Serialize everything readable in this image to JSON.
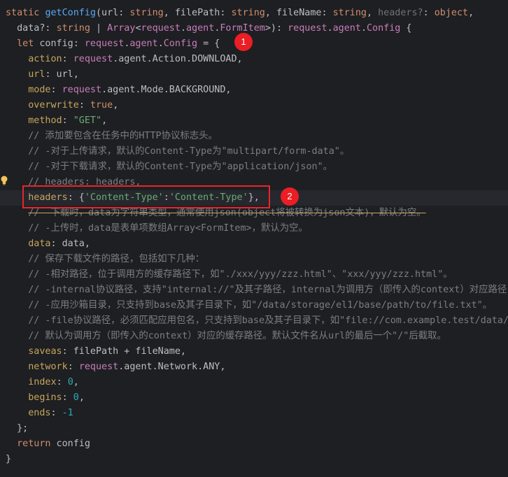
{
  "editor": {
    "lines": [
      "static getConfig(url: string, filePath: string, fileName: string, headers?: object,",
      "  data?: string | Array<request.agent.FormItem>): request.agent.Config {",
      "  let config: request.agent.Config = {",
      "    action: request.agent.Action.DOWNLOAD,",
      "    url: url,",
      "    mode: request.agent.Mode.BACKGROUND,",
      "    overwrite: true,",
      "    method: \"GET\",",
      "    // 添加要包含在任务中的HTTP协议标志头。",
      "    // -对于上传请求，默认的Content-Type为\"multipart/form-data\"。",
      "    // -对于下载请求，默认的Content-Type为\"application/json\"。",
      "    // headers: headers,",
      "    headers: {'Content-Type':'Content-Type'},",
      "    // -下载时，data为字符串类型，通常使用json(object将被转换为json文本)，默认为空。",
      "    // -上传时，data是表单项数组Array<FormItem>，默认为空。",
      "    data: data,",
      "    // 保存下载文件的路径，包括如下几种：",
      "    // -相对路径，位于调用方的缓存路径下，如\"./xxx/yyy/zzz.html\"、\"xxx/yyy/zzz.html\"。",
      "    // -internal协议路径，支持\"internal://\"及其子路径，internal为调用方（即传入的context）对应路径，",
      "    // -应用沙箱目录，只支持到base及其子目录下，如\"/data/storage/el1/base/path/to/file.txt\"。",
      "    // -file协议路径，必须匹配应用包名，只支持到base及其子目录下，如\"file://com.example.test/data/st",
      "    // 默认为调用方（即传入的context）对应的缓存路径。默认文件名从url的最后一个\"/\"后截取。",
      "    saveas: filePath + fileName,",
      "    network: request.agent.Network.ANY,",
      "    index: 0,",
      "    begins: 0,",
      "    ends: -1",
      "  };",
      "  return config",
      "}"
    ]
  },
  "annotations": {
    "badge1": "1",
    "badge2": "2"
  },
  "colors": {
    "background": "#1e1f22",
    "keyword": "#cf8e6d",
    "function": "#56a8f5",
    "string": "#6aab73",
    "number": "#2aacb8",
    "comment": "#7a7e85",
    "property": "#c7a65d",
    "annotation": "#e8252c"
  }
}
